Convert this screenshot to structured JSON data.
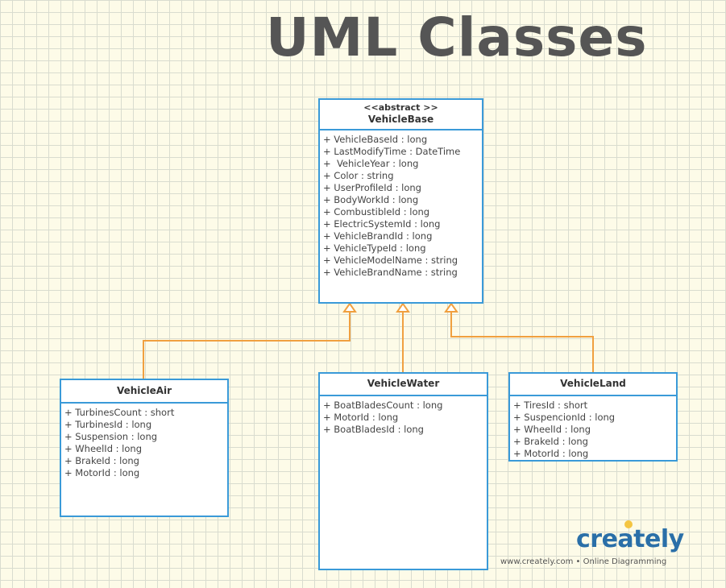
{
  "title": "UML Classes",
  "classes": {
    "base": {
      "stereotype": "<<abstract >>",
      "name": "VehicleBase",
      "attributes": [
        "+ VehicleBaseId : long",
        "+ LastModifyTime : DateTime",
        "+  VehicleYear : long",
        "+ Color : string",
        "+ UserProfileId : long",
        "+ BodyWorkId : long",
        "+ CombustibleId : long",
        "+ ElectricSystemId : long",
        "+ VehicleBrandId : long",
        "+ VehicleTypeId : long",
        "+ VehicleModelName : string",
        "+ VehicleBrandName : string"
      ]
    },
    "air": {
      "name": "VehicleAir",
      "attributes": [
        "+ TurbinesCount : short",
        "+ TurbinesId : long",
        "+ Suspension : long",
        "+ WheelId : long",
        "+ BrakeId : long",
        "+ MotorId : long"
      ]
    },
    "water": {
      "name": "VehicleWater",
      "attributes": [
        "+ BoatBladesCount : long",
        "+ MotorId : long",
        "+ BoatBladesId : long"
      ]
    },
    "land": {
      "name": "VehicleLand",
      "attributes": [
        "+ TiresId : short",
        "+ SuspencionId : long",
        "+ WheelId : long",
        "+ BrakeId : long",
        "+ MotorId : long"
      ]
    }
  },
  "relations": [
    {
      "from": "VehicleAir",
      "to": "VehicleBase",
      "type": "generalization"
    },
    {
      "from": "VehicleWater",
      "to": "VehicleBase",
      "type": "generalization"
    },
    {
      "from": "VehicleLand",
      "to": "VehicleBase",
      "type": "generalization"
    }
  ],
  "colors": {
    "class_border": "#3a9ad8",
    "connector": "#f0a040",
    "title": "#555555",
    "background": "#fdfbe8"
  },
  "watermark": {
    "logo": "creately",
    "tagline": "www.creately.com • Online Diagramming"
  }
}
